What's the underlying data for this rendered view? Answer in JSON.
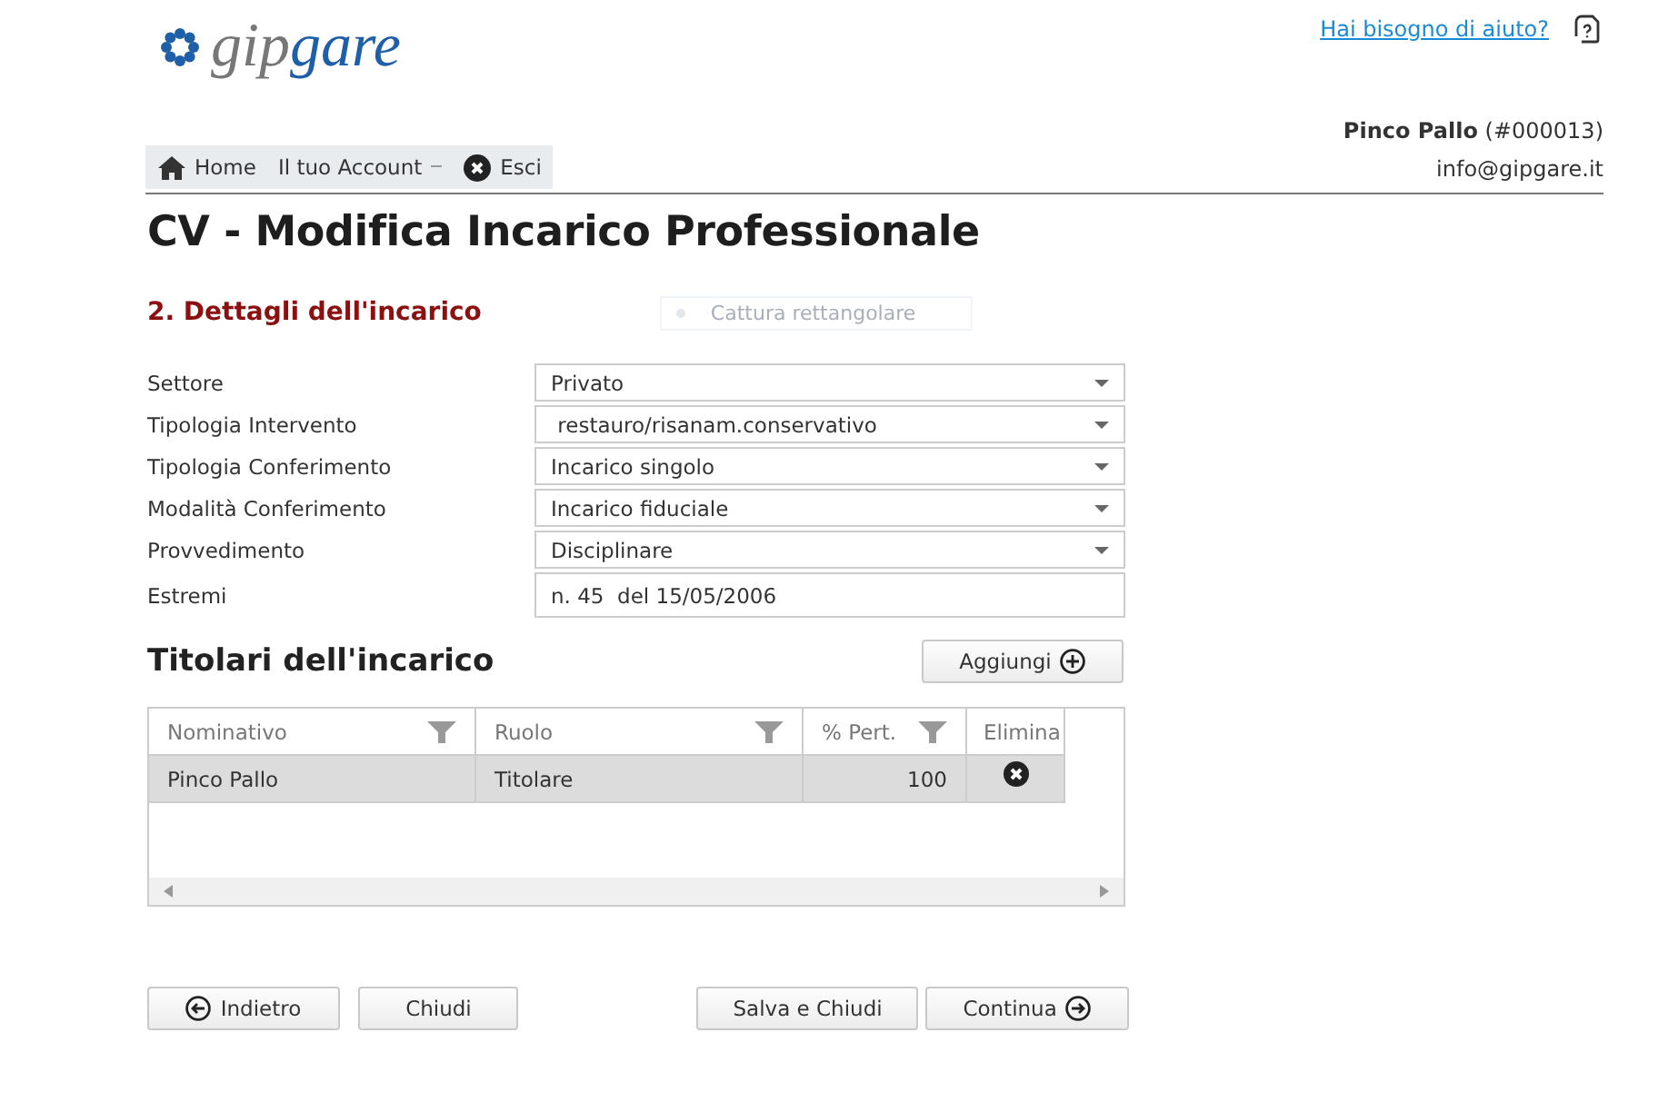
{
  "logo": {
    "part_1": "gip",
    "part_2": "gare"
  },
  "help_link": "Hai bisogno di aiuto?",
  "nav": [
    {
      "kind": "home",
      "label": "Home"
    },
    {
      "kind": "dropdown",
      "label": "Il tuo Account"
    },
    {
      "kind": "exit",
      "label": "Esci"
    }
  ],
  "user": {
    "name": "Pinco Pallo",
    "code": "(#000013)",
    "email": "info@gipgare.it"
  },
  "title": "CV - Modifica Incarico Professionale",
  "section": "2. Dettagli dell'incarico",
  "capture_tool": {
    "label": "Cattura rettangolare"
  },
  "fields": [
    {
      "kind": "select",
      "label": "Settore",
      "value": "Privato"
    },
    {
      "kind": "select",
      "label": "Tipologia Intervento",
      "value": " restauro/risanam.conservativo"
    },
    {
      "kind": "select",
      "label": "Tipologia Conferimento",
      "value": "Incarico singolo"
    },
    {
      "kind": "select",
      "label": "Modalità Conferimento",
      "value": "Incarico fiduciale"
    },
    {
      "kind": "select",
      "label": "Provvedimento",
      "value": "Disciplinare"
    },
    {
      "kind": "text",
      "label": "Estremi",
      "value": "n. 45  del 15/05/2006"
    }
  ],
  "holders": {
    "title": "Titolari dell'incarico",
    "add_button": "Aggiungi",
    "table": {
      "columns": [
        {
          "label": "Nominativo",
          "filter": true
        },
        {
          "label": "Ruolo",
          "filter": true
        },
        {
          "label": "% Pert.",
          "filter": true
        },
        {
          "label": "Elimina",
          "filter": false
        }
      ],
      "rows": [
        {
          "selected": true,
          "cells": [
            "Pinco Pallo",
            "Titolare",
            "100"
          ]
        }
      ]
    }
  },
  "buttons": [
    {
      "kind": "back",
      "label": "Indietro"
    },
    {
      "kind": "plain",
      "label": "Chiudi"
    },
    {
      "kind": "plain",
      "label": "Salva e Chiudi"
    },
    {
      "kind": "next",
      "label": "Continua"
    }
  ]
}
